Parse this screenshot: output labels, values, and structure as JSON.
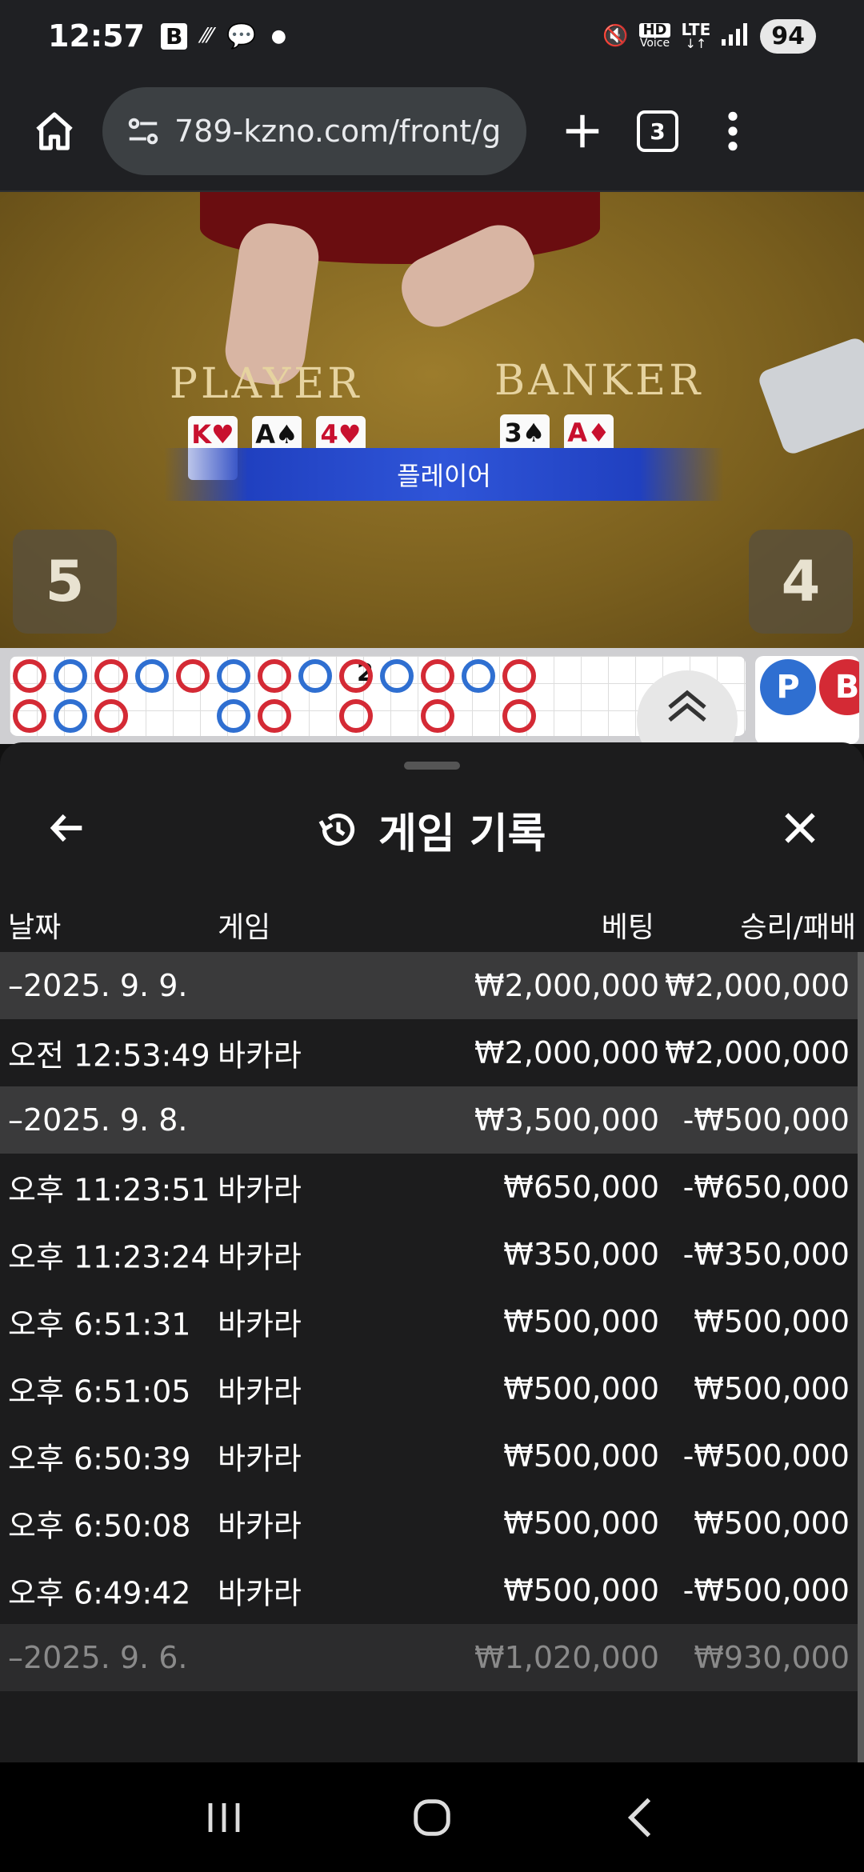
{
  "status_bar": {
    "time": "12:57",
    "left_icons": [
      "b-app-icon",
      "tilde-icon",
      "chat-icon",
      "dot-icon"
    ],
    "right_icons": [
      "mute-icon",
      "hd-voice-icon",
      "lte-icon",
      "signal-icon"
    ],
    "hd_label": "HD",
    "voice_label": "Voice",
    "lte_label": "LTE",
    "battery": "94"
  },
  "browser": {
    "url": "789-kzno.com/front/g",
    "tab_count": "3"
  },
  "game": {
    "player_label": "PLAYER",
    "banker_label": "BANKER",
    "player_cards": [
      {
        "rank": "K",
        "suit": "♥",
        "color": "red"
      },
      {
        "rank": "A",
        "suit": "♠",
        "color": "black"
      },
      {
        "rank": "4",
        "suit": "♥",
        "color": "red"
      }
    ],
    "banker_cards": [
      {
        "rank": "3",
        "suit": "♠",
        "color": "black"
      },
      {
        "rank": "A",
        "suit": "♦",
        "color": "red"
      }
    ],
    "result_banner": "플레이어",
    "player_score": "5",
    "banker_score": "4",
    "road_number": "2",
    "pb_labels": [
      "P",
      "B",
      "P"
    ]
  },
  "sheet": {
    "title": "게임 기록",
    "columns": {
      "date": "날짜",
      "game": "게임",
      "bet": "베팅",
      "win_loss": "승리/패배"
    },
    "rows": [
      {
        "type": "date",
        "date": "–2025. 9. 9.",
        "game": "",
        "bet": "₩2,000,000",
        "win": "₩2,000,000"
      },
      {
        "type": "entry",
        "date": "오전 12:53:49",
        "game": "바카라",
        "bet": "₩2,000,000",
        "win": "₩2,000,000"
      },
      {
        "type": "date",
        "date": "–2025. 9. 8.",
        "game": "",
        "bet": "₩3,500,000",
        "win": "-₩500,000"
      },
      {
        "type": "entry",
        "date": "오후 11:23:51",
        "game": "바카라",
        "bet": "₩650,000",
        "win": "-₩650,000"
      },
      {
        "type": "entry",
        "date": "오후 11:23:24",
        "game": "바카라",
        "bet": "₩350,000",
        "win": "-₩350,000"
      },
      {
        "type": "entry",
        "date": "오후 6:51:31",
        "game": "바카라",
        "bet": "₩500,000",
        "win": "₩500,000"
      },
      {
        "type": "entry",
        "date": "오후 6:51:05",
        "game": "바카라",
        "bet": "₩500,000",
        "win": "₩500,000"
      },
      {
        "type": "entry",
        "date": "오후 6:50:39",
        "game": "바카라",
        "bet": "₩500,000",
        "win": "-₩500,000"
      },
      {
        "type": "entry",
        "date": "오후 6:50:08",
        "game": "바카라",
        "bet": "₩500,000",
        "win": "₩500,000"
      },
      {
        "type": "entry",
        "date": "오후 6:49:42",
        "game": "바카라",
        "bet": "₩500,000",
        "win": "-₩500,000"
      },
      {
        "type": "date",
        "date": "–2025. 9. 6.",
        "game": "",
        "bet": "₩1,020,000",
        "win": "₩930,000"
      }
    ]
  },
  "colors": {
    "player_blue": "#2f6fd1",
    "banker_red": "#d42a35",
    "sheet_bg": "#1c1c1d",
    "date_row_bg": "#3a3a3b"
  },
  "nav": {
    "buttons": [
      "recents-icon",
      "home-icon",
      "back-icon"
    ]
  }
}
